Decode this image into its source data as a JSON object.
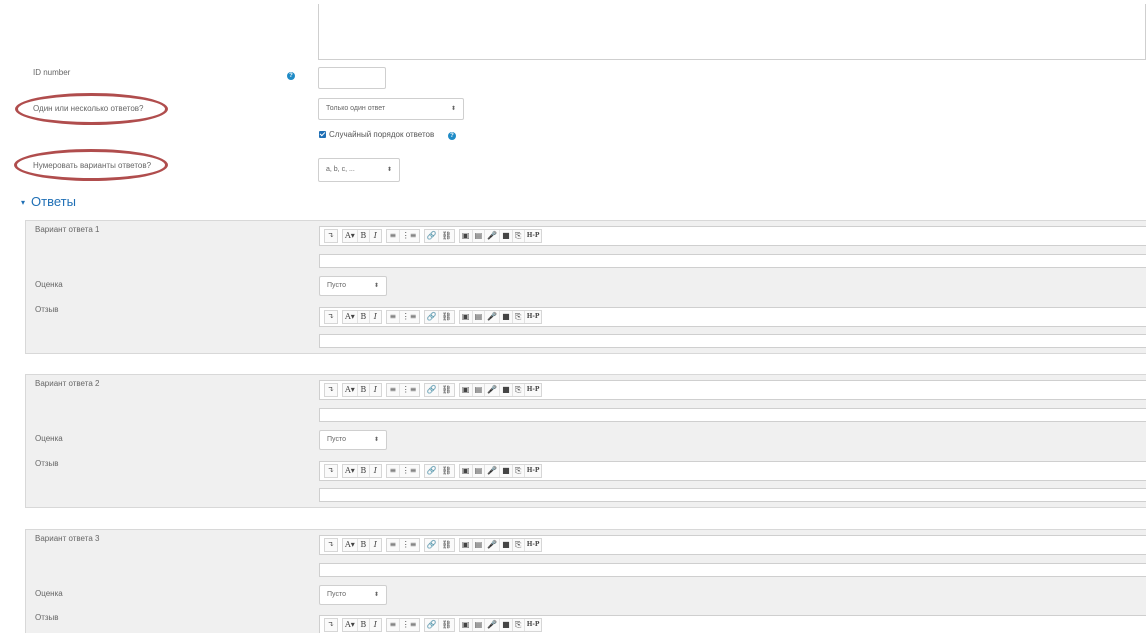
{
  "form": {
    "id_number_label": "ID number",
    "id_number_value": "",
    "single_label": "Один или несколько ответов?",
    "single_value": "Только один ответ",
    "shuffle_label": "Случайный порядок ответов",
    "numbering_label": "Нумеровать варианты ответов?",
    "numbering_value": "a, b, c, ..."
  },
  "section": {
    "title": "Ответы"
  },
  "answers": [
    {
      "label": "Вариант ответа 1",
      "grade_label": "Оценка",
      "grade_value": "Пусто",
      "feedback_label": "Отзыв"
    },
    {
      "label": "Вариант ответа 2",
      "grade_label": "Оценка",
      "grade_value": "Пусто",
      "feedback_label": "Отзыв"
    },
    {
      "label": "Вариант ответа 3",
      "grade_label": "Оценка",
      "grade_value": "Пусто",
      "feedback_label": "Отзыв"
    }
  ],
  "toolbar": {
    "buttons": [
      "↴",
      "A▾",
      "B",
      "I",
      "≡",
      "⋮≡",
      "🔗",
      "⛓",
      "▣",
      "▤",
      "🎤",
      "■",
      "⎘",
      "H-P"
    ]
  },
  "highlight_color": "#b04d4d",
  "accent_color": "#1f6fb5"
}
